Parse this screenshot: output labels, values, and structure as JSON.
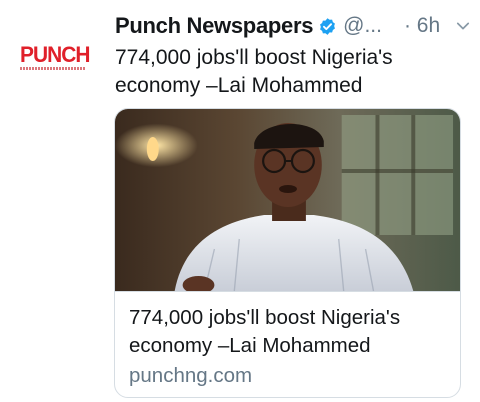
{
  "tweet": {
    "author_name": "Punch Newspapers",
    "handle": "@...",
    "time": "· 6h",
    "text": "774,000 jobs'll boost Nigeria's economy –Lai Mohammed"
  },
  "avatar": {
    "logo_text": "PUNCH",
    "logo_color": "#e0202a"
  },
  "card": {
    "title": "774,000 jobs'll boost Nigeria's economy –Lai Mohammed",
    "domain": "punchng.com"
  },
  "colors": {
    "text": "#14171a",
    "secondary": "#657786",
    "verified": "#1da1f2",
    "border": "#d6dde3"
  },
  "icons": {
    "verified": "verified-badge-icon",
    "caret": "chevron-down-icon"
  }
}
